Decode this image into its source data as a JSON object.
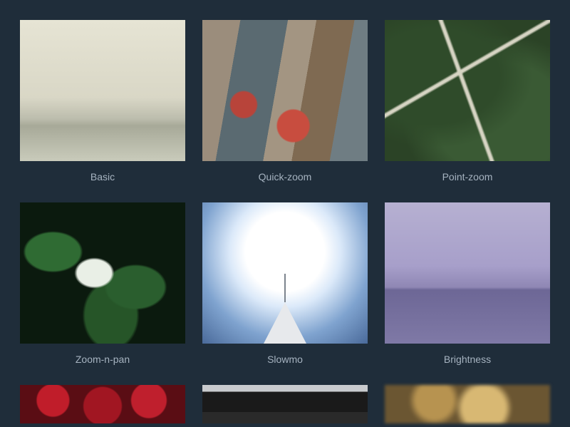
{
  "gallery": {
    "items": [
      {
        "label": "Basic",
        "style": "t-basic"
      },
      {
        "label": "Quick-zoom",
        "style": "t-quickzoom"
      },
      {
        "label": "Point-zoom",
        "style": "t-pointzoom"
      },
      {
        "label": "Zoom-n-pan",
        "style": "t-zoompan"
      },
      {
        "label": "Slowmo",
        "style": "t-slowmo"
      },
      {
        "label": "Brightness",
        "style": "t-brightness"
      }
    ],
    "partial_row": [
      {
        "style": "t-r3a"
      },
      {
        "style": "t-r3b"
      },
      {
        "style": "t-r3c"
      }
    ]
  }
}
